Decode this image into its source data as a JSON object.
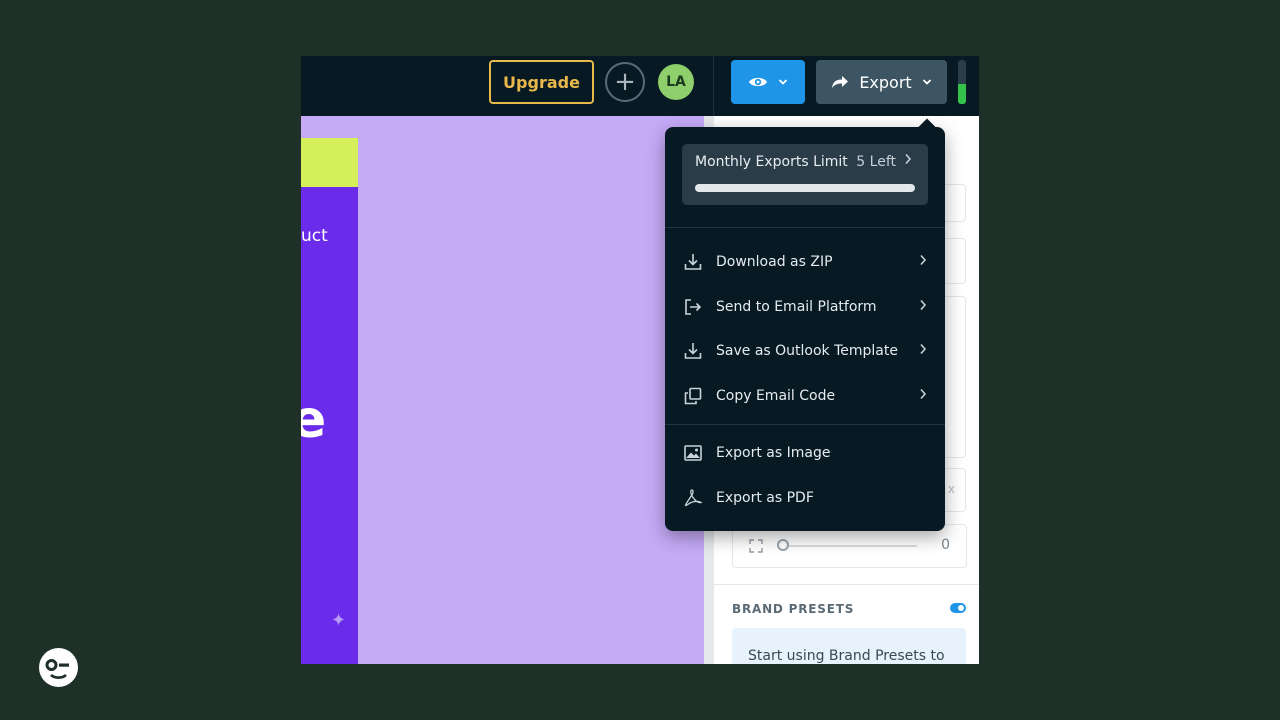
{
  "topbar": {
    "upgrade_label": "Upgrade",
    "avatar_initials": "LA",
    "export_label": "Export",
    "usage_meter_fraction": 0.45
  },
  "canvas": {
    "partial_text": "uct",
    "partial_glyph": "e"
  },
  "right_panel": {
    "slider_value": "0",
    "partial_unit": "x",
    "brand_presets_title": "BRAND PRESETS",
    "brand_presets_enabled": true,
    "brand_presets_text": "Start using Brand Presets to"
  },
  "export_menu": {
    "limit_title": "Monthly Exports Limit",
    "limit_remaining": "5 Left",
    "limit_used_fraction": 1.0,
    "items": [
      {
        "label": "Download as ZIP",
        "icon": "download-icon",
        "submenu": true
      },
      {
        "label": "Send to Email Platform",
        "icon": "send-external-icon",
        "submenu": true
      },
      {
        "label": "Save as Outlook Template",
        "icon": "download-icon",
        "submenu": true
      },
      {
        "label": "Copy Email Code",
        "icon": "copy-icon",
        "submenu": true
      },
      {
        "label": "Export as Image",
        "icon": "image-icon",
        "submenu": false
      },
      {
        "label": "Export as PDF",
        "icon": "pdf-icon",
        "submenu": false
      }
    ]
  },
  "colors": {
    "background": "#1e3028",
    "topbar": "#071a24",
    "accent_blue": "#1f95e8",
    "upgrade_gold": "#e8b84a",
    "canvas_lavender": "#c5aaf7",
    "canvas_purple": "#6a2bea",
    "canvas_lime": "#d4ef5a",
    "meter_green": "#35c24a"
  }
}
